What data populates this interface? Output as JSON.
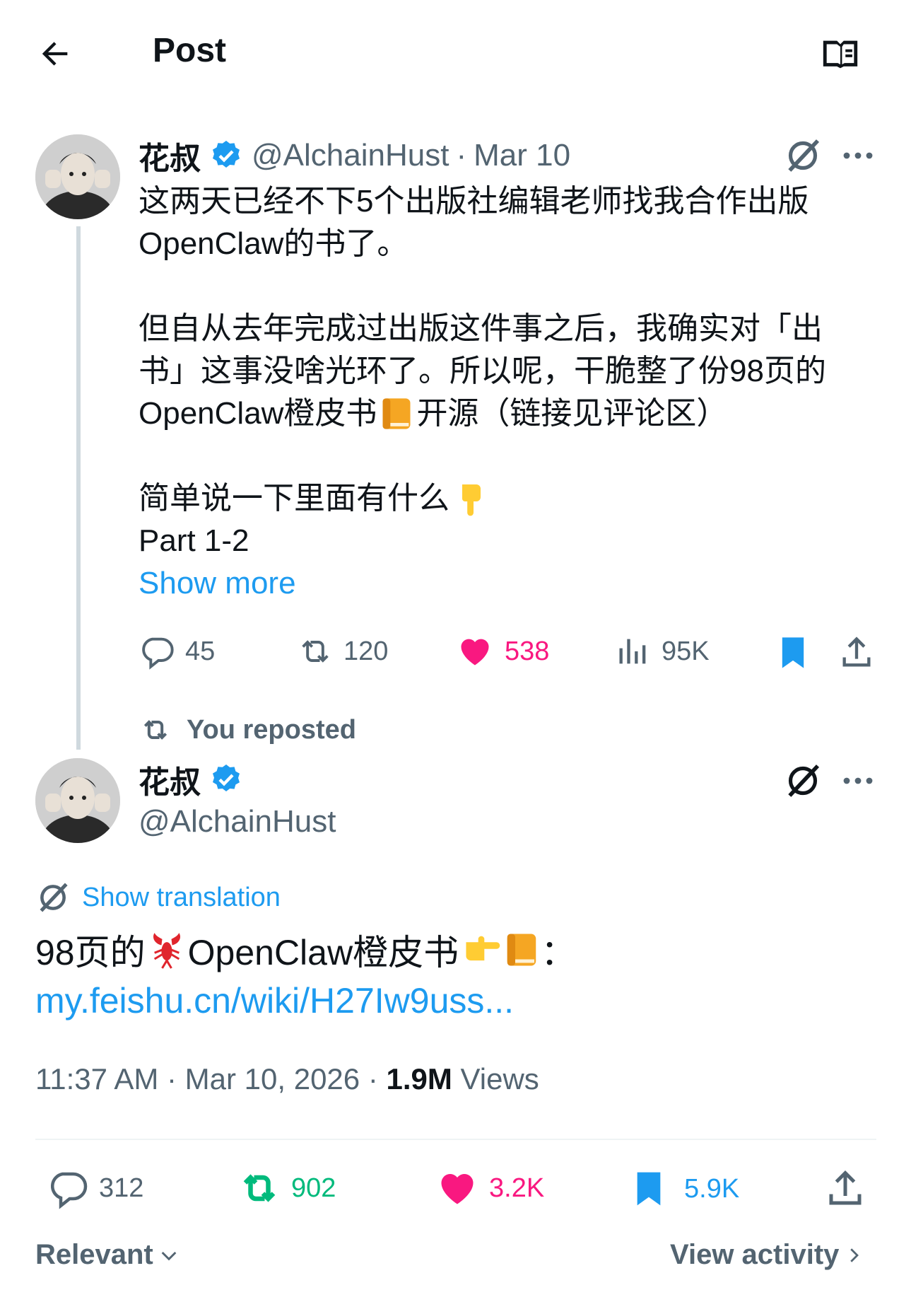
{
  "header": {
    "title": "Post",
    "back_icon": "arrow-left-icon",
    "reader_icon": "open-book-icon"
  },
  "quoted_post": {
    "display_name": "花叔",
    "handle": "@AlchainHust",
    "date": "Mar 10",
    "lines": [
      "这两天已经不下5个出版社编辑老师找我合作出版",
      "OpenClaw的书了。",
      "但自从去年完成过出版这件事之后，我确实对「出",
      "书」这事没啥光环了。所以呢，干脆整了份98页的",
      "OpenClaw橙皮书",
      "开源（链接见评论区）",
      "简单说一下里面有什么",
      "Part 1-2"
    ],
    "show_more": "Show more",
    "stats": {
      "replies": "45",
      "reposts": "120",
      "likes": "538",
      "views": "95K"
    }
  },
  "repost_banner": "You reposted",
  "main_post": {
    "display_name": "花叔",
    "handle": "@AlchainHust",
    "show_translation": "Show translation",
    "text_prefix": "98页的",
    "text_middle": "OpenClaw橙皮书",
    "text_suffix": "：",
    "link": "my.feishu.cn/wiki/H27Iw9uss...",
    "time": "11:37 AM · Mar 10, 2026 · ",
    "views_count": "1.9M",
    "views_label": " Views",
    "stats": {
      "replies": "312",
      "reposts": "902",
      "likes": "3.2K",
      "bookmarks": "5.9K"
    }
  },
  "footer": {
    "sort_label": "Relevant",
    "view_activity": "View activity"
  },
  "colors": {
    "accent": "#1d9bf0",
    "like": "#f91880",
    "repost": "#00ba7c",
    "muted": "#536471"
  }
}
